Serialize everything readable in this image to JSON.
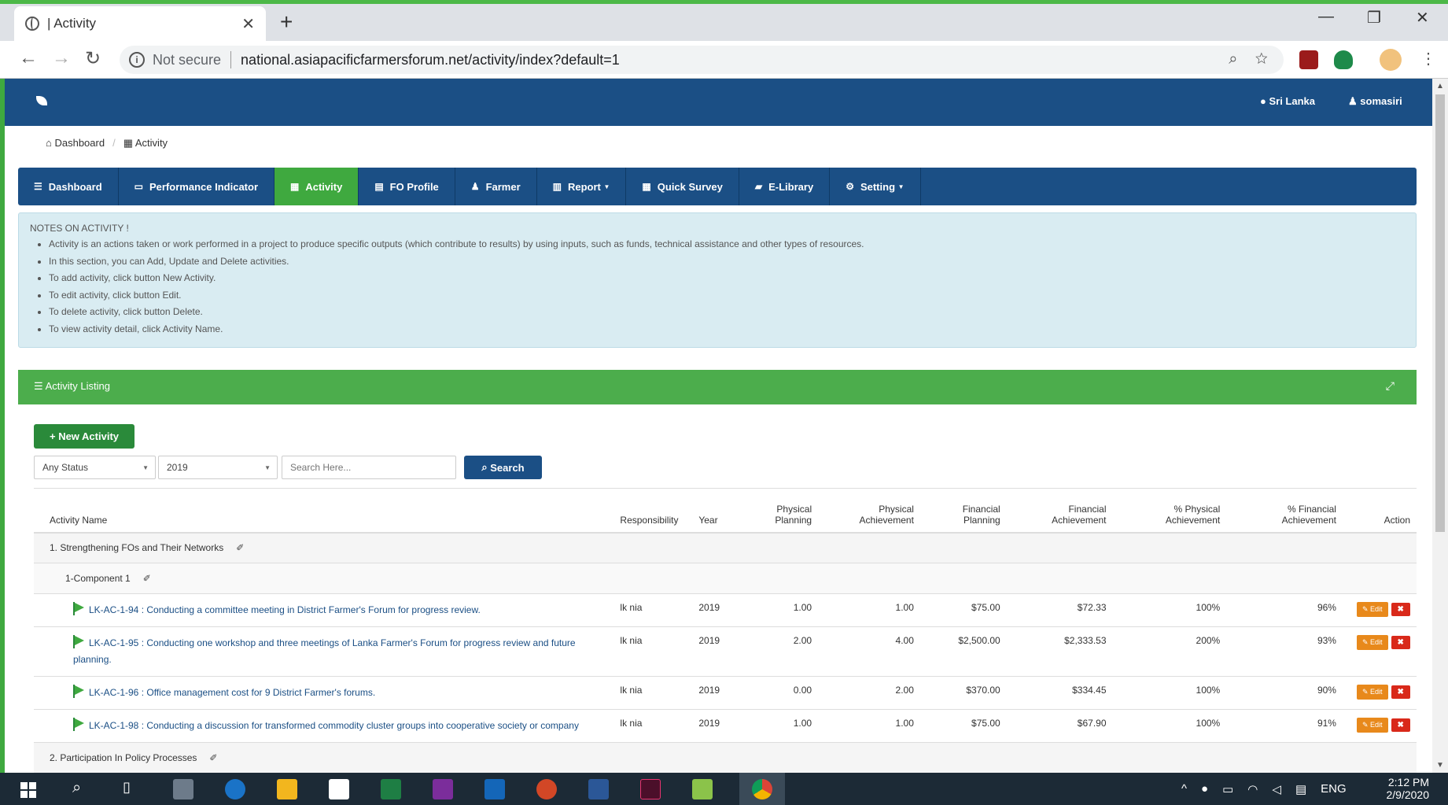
{
  "browser": {
    "tab_title": "| Activity",
    "tab_close": "✕",
    "new_tab": "+",
    "not_secure": "Not secure",
    "url": "national.asiapacificfarmersforum.net/activity/index?default=1",
    "minimize": "—",
    "restore": "❐",
    "close": "✕"
  },
  "topbar": {
    "country": "Sri Lanka",
    "user": "somasiri"
  },
  "breadcrumb": {
    "items": [
      "Dashboard",
      "Activity"
    ]
  },
  "nav": {
    "items": [
      {
        "label": "Dashboard",
        "icon": "list-icon"
      },
      {
        "label": "Performance Indicator",
        "icon": "monitor-icon"
      },
      {
        "label": "Activity",
        "icon": "grid-icon",
        "active": true
      },
      {
        "label": "FO Profile",
        "icon": "card-icon"
      },
      {
        "label": "Farmer",
        "icon": "user-icon"
      },
      {
        "label": "Report",
        "icon": "chart-icon",
        "dropdown": true
      },
      {
        "label": "Quick Survey",
        "icon": "grid-icon"
      },
      {
        "label": "E-Library",
        "icon": "folder-icon"
      },
      {
        "label": "Setting",
        "icon": "gear-icon",
        "dropdown": true
      }
    ]
  },
  "notes": {
    "title": "NOTES ON ACTIVITY !",
    "items": [
      "Activity is an actions taken or work performed in a project to produce specific outputs (which contribute to results) by using inputs, such as funds, technical assistance and other types of resources.",
      "In this section, you can Add, Update and Delete activities.",
      "To add activity, click button New Activity.",
      "To edit activity, click button Edit.",
      "To delete activity, click button Delete.",
      "To view activity detail, click Activity Name."
    ]
  },
  "listing": {
    "title": "Activity Listing",
    "new_button": "New Activity",
    "status_select": "Any Status",
    "year_select": "2019",
    "search_placeholder": "Search Here...",
    "search_button": "Search"
  },
  "table": {
    "headers": {
      "name": "Activity Name",
      "responsibility": "Responsibility",
      "year": "Year",
      "phys_plan": "Physical Planning",
      "phys_ach": "Physical Achievement",
      "fin_plan": "Financial Planning",
      "fin_ach": "Financial Achievement",
      "pct_phys": "% Physical Achievement",
      "pct_fin": "% Financial Achievement",
      "action": "Action"
    },
    "group1": "1. Strengthening FOs and Their Networks",
    "component1": "1-Component 1",
    "rows": [
      {
        "name": "LK-AC-1-94 : Conducting a committee meeting in District Farmer's Forum for progress review.",
        "resp": "lk nia",
        "year": "2019",
        "pp": "1.00",
        "pa": "1.00",
        "fp": "$75.00",
        "fa": "$72.33",
        "pctp": "100%",
        "pctf": "96%"
      },
      {
        "name": "LK-AC-1-95 : Conducting one workshop and three meetings of Lanka Farmer's Forum for progress review and future planning.",
        "resp": "lk nia",
        "year": "2019",
        "pp": "2.00",
        "pa": "4.00",
        "fp": "$2,500.00",
        "fa": "$2,333.53",
        "pctp": "200%",
        "pctf": "93%"
      },
      {
        "name": "LK-AC-1-96 : Office management cost for 9 District Farmer's forums.",
        "resp": "lk nia",
        "year": "2019",
        "pp": "0.00",
        "pa": "2.00",
        "fp": "$370.00",
        "fa": "$334.45",
        "pctp": "100%",
        "pctf": "90%"
      },
      {
        "name": "LK-AC-1-98 : Conducting a discussion for transformed commodity cluster groups into cooperative society or company",
        "resp": "lk nia",
        "year": "2019",
        "pp": "1.00",
        "pa": "1.00",
        "fp": "$75.00",
        "fa": "$67.90",
        "pctp": "100%",
        "pctf": "91%"
      }
    ],
    "edit_label": "Edit",
    "delete_label": "✖",
    "group2": "2. Participation In Policy Processes"
  },
  "taskbar": {
    "time": "2:12 PM",
    "date": "2/9/2020",
    "lang": "ENG"
  },
  "colors": {
    "primary": "#1b4f85",
    "success": "#3fa93f",
    "warning": "#e8891b",
    "danger": "#d9291a"
  }
}
